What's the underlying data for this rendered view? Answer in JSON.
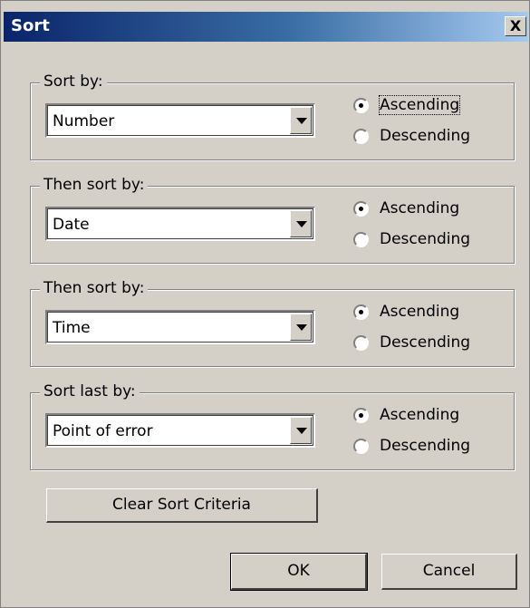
{
  "window": {
    "title": "Sort",
    "close_label": "X"
  },
  "groups": [
    {
      "label": "Sort by:",
      "value": "Number",
      "ascending": "Ascending",
      "descending": "Descending",
      "selected": "ascending"
    },
    {
      "label": "Then sort by:",
      "value": "Date",
      "ascending": "Ascending",
      "descending": "Descending",
      "selected": "ascending"
    },
    {
      "label": "Then sort by:",
      "value": "Time",
      "ascending": "Ascending",
      "descending": "Descending",
      "selected": "ascending"
    },
    {
      "label": "Sort last by:",
      "value": "Point of error",
      "ascending": "Ascending",
      "descending": "Descending",
      "selected": "ascending"
    }
  ],
  "buttons": {
    "clear": "Clear Sort Criteria",
    "ok": "OK",
    "cancel": "Cancel"
  }
}
